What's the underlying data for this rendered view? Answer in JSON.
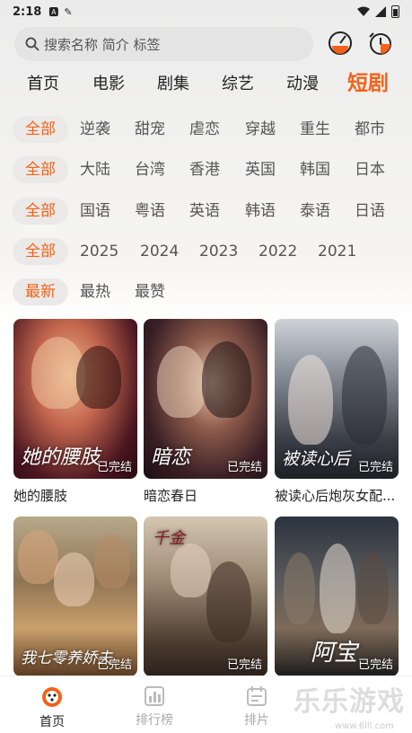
{
  "status": {
    "time": "2:18",
    "icons": [
      "a-icon",
      "notification-icon",
      "wifi-icon",
      "signal-icon",
      "battery-icon"
    ]
  },
  "search": {
    "placeholder": "搜索名称 简介 标签"
  },
  "category_tabs": [
    {
      "label": "首页",
      "active": false
    },
    {
      "label": "电影",
      "active": false
    },
    {
      "label": "剧集",
      "active": false
    },
    {
      "label": "综艺",
      "active": false
    },
    {
      "label": "动漫",
      "active": false
    },
    {
      "label": "短剧",
      "active": true
    }
  ],
  "filters": {
    "genre": [
      "全部",
      "逆袭",
      "甜宠",
      "虐恋",
      "穿越",
      "重生",
      "都市"
    ],
    "region": [
      "全部",
      "大陆",
      "台湾",
      "香港",
      "英国",
      "韩国",
      "日本"
    ],
    "language": [
      "全部",
      "国语",
      "粤语",
      "英语",
      "韩语",
      "泰语",
      "日语"
    ],
    "year": [
      "全部",
      "2025",
      "2024",
      "2023",
      "2022",
      "2021"
    ],
    "sort": [
      "最新",
      "最热",
      "最赞"
    ]
  },
  "accent_color": "#f2621a",
  "cards": [
    {
      "title": "她的腰肢",
      "badge": "已完结",
      "poster_text": "她的腰肢"
    },
    {
      "title": "暗恋春日",
      "badge": "已完结",
      "poster_text": "暗恋"
    },
    {
      "title": "被读心后炮灰女配...",
      "badge": "已完结",
      "poster_text": "被读心后"
    },
    {
      "title": "",
      "badge": "已完结",
      "poster_text": "我七零养娇夫"
    },
    {
      "title": "",
      "badge": "已完结",
      "poster_text": "千金"
    },
    {
      "title": "",
      "badge": "已完结",
      "poster_text": "阿宝"
    }
  ],
  "bottom_nav": [
    {
      "label": "首页",
      "active": true
    },
    {
      "label": "排行榜",
      "active": false
    },
    {
      "label": "排片",
      "active": false
    }
  ],
  "watermark": {
    "text": "乐乐游戏",
    "url": "www.6lll.com"
  }
}
